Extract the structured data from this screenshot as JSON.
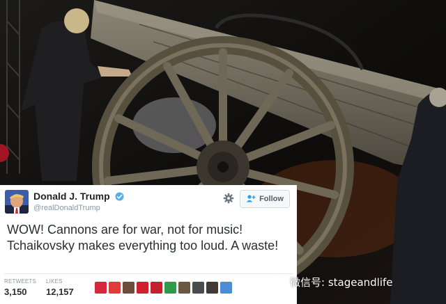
{
  "tweet": {
    "display_name": "Donald J. Trump",
    "handle": "@realDonaldTrump",
    "follow_label": "Follow",
    "text": "WOW! Cannons are for war, not for music! Tchaikovsky makes everything too loud. A waste!",
    "stats": [
      {
        "label": "RETWEETS",
        "value": "3,150"
      },
      {
        "label": "LIKES",
        "value": "12,157"
      }
    ],
    "liker_avatar_colors": [
      "#d6283c",
      "#e03a3a",
      "#6b4d3a",
      "#d11f2f",
      "#c3212e",
      "#2f9a4a",
      "#6a5842",
      "#4b4b4b",
      "#3f3a35",
      "#4a8fd6"
    ]
  },
  "watermark": {
    "text": "微信号: stageandlife",
    "icon": "wechat-icon"
  },
  "colors": {
    "verified": "#55acee",
    "follow_icon": "#1da1f2",
    "text": "#292f33",
    "muted": "#8899a6"
  }
}
